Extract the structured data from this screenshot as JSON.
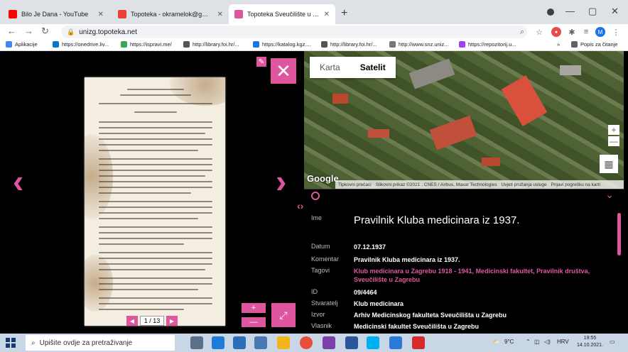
{
  "browser": {
    "tabs": [
      {
        "title": "Bilo Je Dana - YouTube",
        "fav_color": "#ff0000"
      },
      {
        "title": "Topoteka - okramelok@gmail.co",
        "fav_color": "#ea4335"
      },
      {
        "title": "Topoteka Sveučilište u Zagrebu",
        "fav_color": "#e0569e"
      }
    ],
    "new_tab": "+",
    "url": "unizg.topoteka.net",
    "window_controls": {
      "minimize": "—",
      "maximize": "▢",
      "close": "✕"
    },
    "profile_initial": "M"
  },
  "bookmarks": {
    "items": [
      {
        "label": "Aplikacije",
        "color": "#4285f4"
      },
      {
        "label": "https://onedrive.liv...",
        "color": "#0078d4"
      },
      {
        "label": "https://ispravi.me/",
        "color": "#34a853"
      },
      {
        "label": "http://library.foi.hr/...",
        "color": "#555555"
      },
      {
        "label": "https://katalog.kgz....",
        "color": "#1a73e8"
      },
      {
        "label": "http://library.foi.hr/...",
        "color": "#555555"
      },
      {
        "label": "http://www.snz.uniz...",
        "color": "#777777"
      },
      {
        "label": "https://repozitorij.u...",
        "color": "#a142f4"
      }
    ],
    "more": "»",
    "reading_list": "Popis za čitanje"
  },
  "viewer": {
    "page_current": "1 / 13",
    "prev_page": "◀",
    "next_page": "▶",
    "zoom_in": "+",
    "zoom_out": "—",
    "fullscreen": "⤢",
    "close": "✕",
    "tools": "🔧",
    "prev_arrow": "‹",
    "next_arrow": "›"
  },
  "map": {
    "type_map": "Karta",
    "type_satellite": "Satelit",
    "google": "Google",
    "attribution": [
      "Tipkovni prečaci",
      "Slikovni prikaz ©2021 , CNES / Airbus, Maxar Technologies",
      "Uvjeti pružanja usluge",
      "Prijavi pogrešku na karti"
    ],
    "zoom_in": "+",
    "zoom_out": "—"
  },
  "record": {
    "title_label": "Ime",
    "title": "Pravilnik Kluba medicinara iz 1937.",
    "fields": [
      {
        "label": "Datum",
        "value": "07.12.1937",
        "pink": false
      },
      {
        "label": "Komentar",
        "value": "Pravilnik Kluba medicinara iz 1937.",
        "pink": false
      },
      {
        "label": "Tagovi",
        "value": "Klub medicinara u Zagrebu 1918 - 1941, Medicinski fakultet, Pravilnik društva, Sveučilište u Zagrebu",
        "pink": true
      },
      {
        "label": "ID",
        "value": "09/4464",
        "pink": false
      },
      {
        "label": "Stvaratelj",
        "value": "Klub medicinara",
        "pink": false
      },
      {
        "label": "Izvor",
        "value": "Arhiv Medicinskog fakulteta Sveučilišta u Zagrebu",
        "pink": false
      },
      {
        "label": "Vlasnik",
        "value": "Medicinski fakultet Sveučilišta u Zagrebu",
        "pink": false
      }
    ],
    "toggle": "‹›"
  },
  "taskbar": {
    "search_placeholder": "Upišite ovdje za pretraživanje",
    "weather": "9°C",
    "language": "HRV",
    "time": "19:55",
    "date": "14.10.2021."
  },
  "colors": {
    "accent": "#e0569e"
  }
}
